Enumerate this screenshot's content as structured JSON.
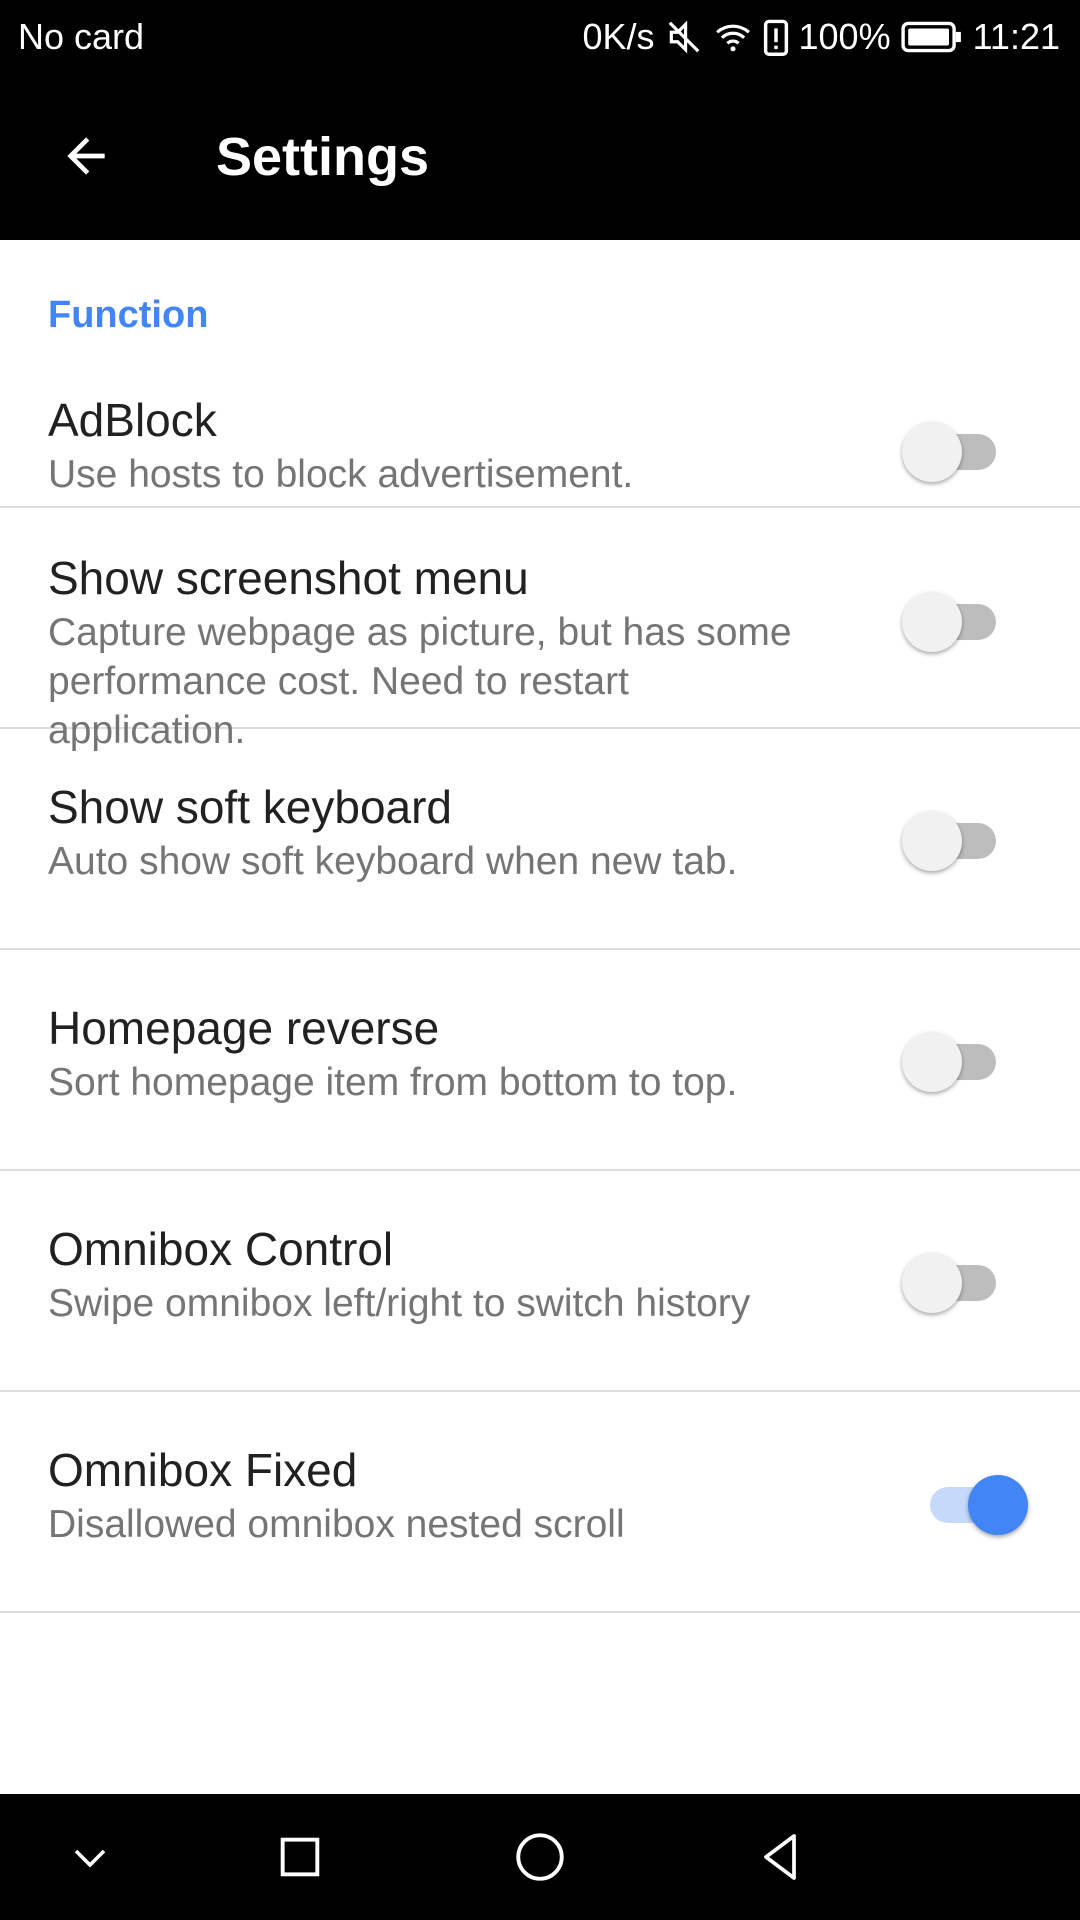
{
  "status_bar": {
    "carrier": "No card",
    "speed": "0K/s",
    "battery": "100%",
    "time": "11:21",
    "icons": [
      "mute-icon",
      "wifi-icon",
      "battery-alert-icon",
      "battery-icon"
    ]
  },
  "toolbar": {
    "back_icon": "arrow-back-icon",
    "title": "Settings"
  },
  "section": {
    "title": "Function"
  },
  "preferences": [
    {
      "title": "AdBlock",
      "summary": "Use hosts to block advertisement.",
      "enabled": false
    },
    {
      "title": "Show screenshot menu",
      "summary": "Capture webpage as picture, but has some performance cost. Need to restart application.",
      "enabled": false
    },
    {
      "title": "Show soft keyboard",
      "summary": "Auto show soft keyboard when new tab.",
      "enabled": false
    },
    {
      "title": "Homepage reverse",
      "summary": "Sort homepage item from bottom to top.",
      "enabled": false
    },
    {
      "title": "Omnibox Control",
      "summary": "Swipe omnibox left/right to switch history",
      "enabled": false
    },
    {
      "title": "Omnibox Fixed",
      "summary": "Disallowed omnibox nested scroll",
      "enabled": true
    }
  ],
  "nav_bar": {
    "icons": [
      "chevron-down-icon",
      "recents-square-icon",
      "home-circle-icon",
      "back-triangle-icon"
    ]
  },
  "colors": {
    "accent": "#4285f4",
    "bar_background": "#000000",
    "divider": "#dedede"
  }
}
